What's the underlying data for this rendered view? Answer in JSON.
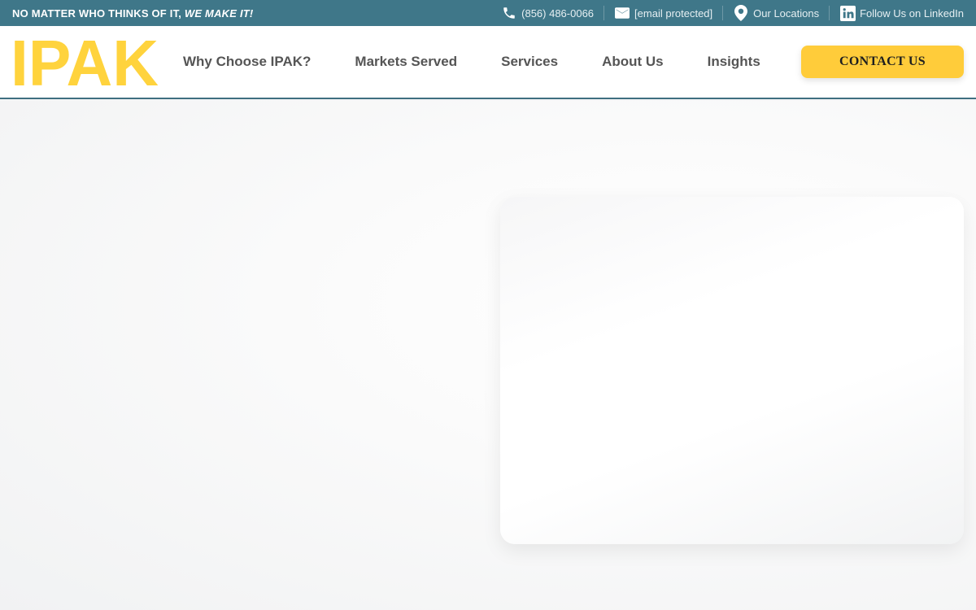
{
  "topbar": {
    "tagline_main": "NO MATTER WHO THINKS OF IT, ",
    "tagline_emphasis": "WE MAKE IT!",
    "links": [
      {
        "icon": "phone-icon",
        "label": "(856) 486-0066"
      },
      {
        "icon": "email-icon",
        "label": "[email protected]"
      },
      {
        "icon": "location-pin-icon",
        "label": "Our Locations"
      },
      {
        "icon": "linkedin-icon",
        "label": "Follow Us on LinkedIn"
      }
    ]
  },
  "header": {
    "logo_text": "IPAK",
    "nav": [
      {
        "label": "Why Choose IPAK?"
      },
      {
        "label": "Markets Served"
      },
      {
        "label": "Services"
      },
      {
        "label": "About Us"
      },
      {
        "label": "Insights"
      }
    ],
    "contact_label": "CONTACT US"
  },
  "colors": {
    "topbar_bg": "#3f7789",
    "brand_yellow": "#ffcc3a",
    "nav_text": "#555555",
    "header_border": "#3f6f80"
  }
}
